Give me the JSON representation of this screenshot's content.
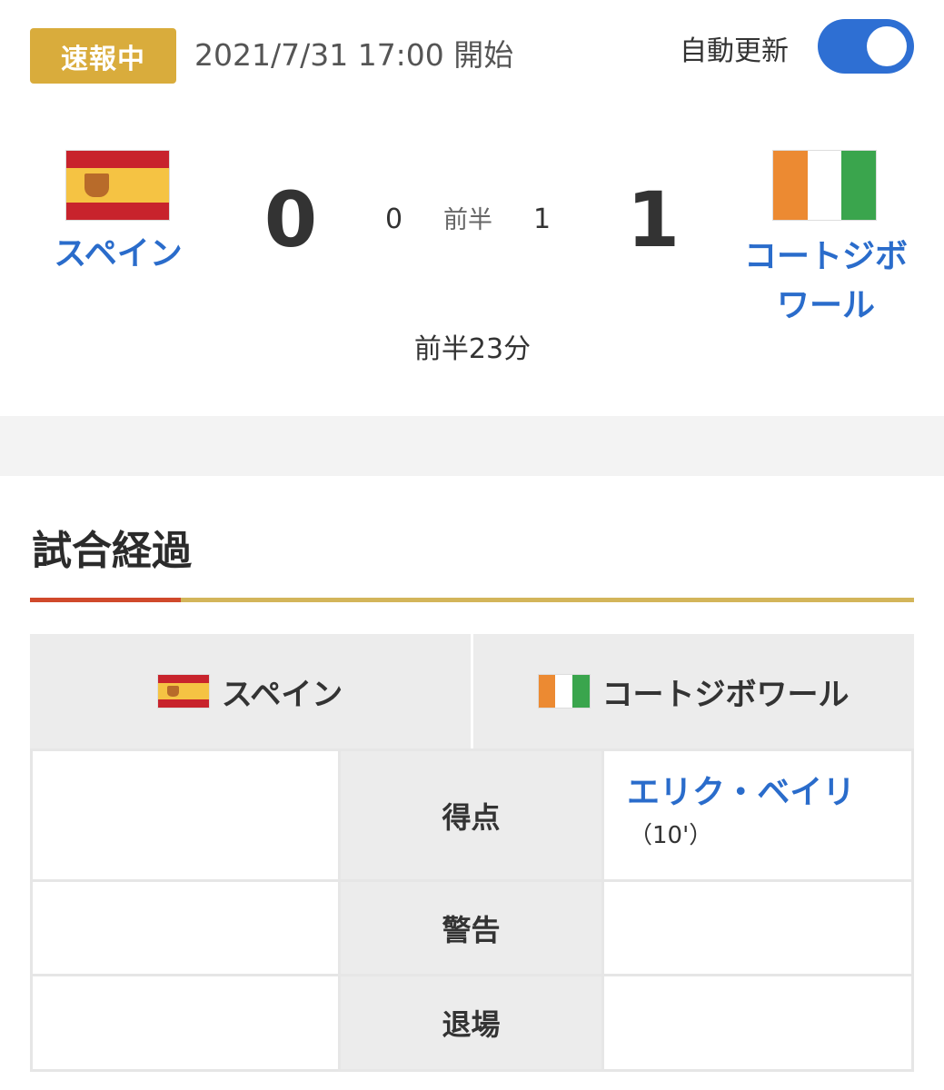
{
  "header": {
    "live_badge": "速報中",
    "start_time": "2021/7/31 17:00 開始",
    "auto_update_label": "自動更新",
    "auto_update_on": true
  },
  "scoreboard": {
    "home": {
      "name": "スペイン",
      "score": "0",
      "first_half": "0",
      "flag": "spain-flag-icon"
    },
    "away": {
      "name_line1": "コートジボ",
      "name_line2": "ワール",
      "score": "1",
      "first_half": "1",
      "flag": "cote-divoire-flag-icon"
    },
    "half_label": "前半",
    "status": "前半23分"
  },
  "progress": {
    "title": "試合経過",
    "home_team": "スペイン",
    "away_team": "コートジボワール",
    "rows": [
      {
        "label": "得点",
        "home": "",
        "away_name": "エリク・ベイリ",
        "away_minute": "（10'）"
      },
      {
        "label": "警告",
        "home": "",
        "away_name": ""
      },
      {
        "label": "退場",
        "home": "",
        "away_name": ""
      }
    ]
  },
  "colors": {
    "badge": "#d9ac3c",
    "toggle": "#2e6fd3",
    "team_link": "#2a6ccb",
    "accent_red": "#d0492b",
    "accent_gold": "#d3b55a"
  }
}
